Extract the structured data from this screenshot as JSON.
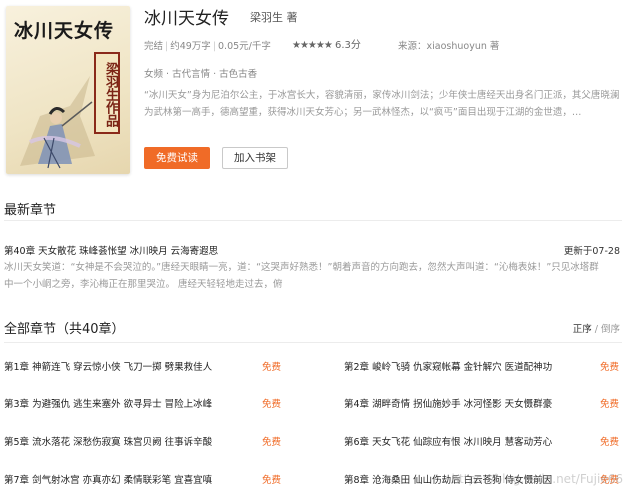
{
  "book": {
    "title": "冰川天女传",
    "author": "梁羽生 著",
    "status": "完结",
    "word_count": "约49万字",
    "price": "0.05元/千字",
    "rating": "6.3分",
    "stars_filled": 5,
    "source": "来源：xiaoshuoyun 著",
    "tags": [
      "女频",
      "古代言情",
      "古色古香"
    ],
    "description": "“冰川天女”身为尼泊尔公主，于冰宫长大，容貌清丽，家传冰川剑法；少年侠士唐经天出身名门正派，其父唐晓澜为武林第一高手，德高望重，获得冰川天女芳心；另一武林怪杰，以“疯丐”面目出现于江湖的金世遗，…",
    "cover": {
      "title": "冰川天女传",
      "author_stamp": "梁羽生作品"
    }
  },
  "actions": {
    "read_free": "免费试读",
    "add_shelf": "加入书架"
  },
  "latest": {
    "section_title": "最新章节",
    "chapter": "第40章 天女散花 珠峰荟怅望 冰川映月 云海寄遐思",
    "updated": "更新于07-28",
    "excerpt": "冰川天女笑道：“女神是不会哭泣的。”唐经天眼睛一亮，道：“这哭声好熟悉！”朝着声音的方向跑去，忽然大声叫道：“沁梅表妹！”只见冰塔群中一个小峒之旁，李沁梅正在那里哭泣。 唐经天轻轻地走过去，俯"
  },
  "all": {
    "section_title": "全部章节（共40章）",
    "sort_active": "正序",
    "sort_sep": " / ",
    "sort_inactive": "倒序",
    "free_label": "免费",
    "chapters": [
      "第1章 神箭连飞 穿云惊小侠 飞刀一掷 劈果救佳人",
      "第2章 峻岭飞骑 仇家窥帐幕 金针解穴 医道配神功",
      "第3章 为避强仇 逃生来塞外 欲寻异士 冒险上冰峰",
      "第4章 湖畔奇情 拐仙施妙手 冰河怪影 天女慑群豪",
      "第5章 流水落花 深愁伤寂寞 珠宫贝阙 往事诉辛酸",
      "第6章 天女飞花 仙踪应有恨 冰川映月 慧客动芳心",
      "第7章 剑气射冰宫 亦真亦幻 柔情联彩笔 宜喜宜嗔",
      "第8章 沧海桑田 仙山伤劫后 白云苍狗 侍女慑前因"
    ]
  },
  "watermark": "https://blog.csdn.net/Fujie66"
}
